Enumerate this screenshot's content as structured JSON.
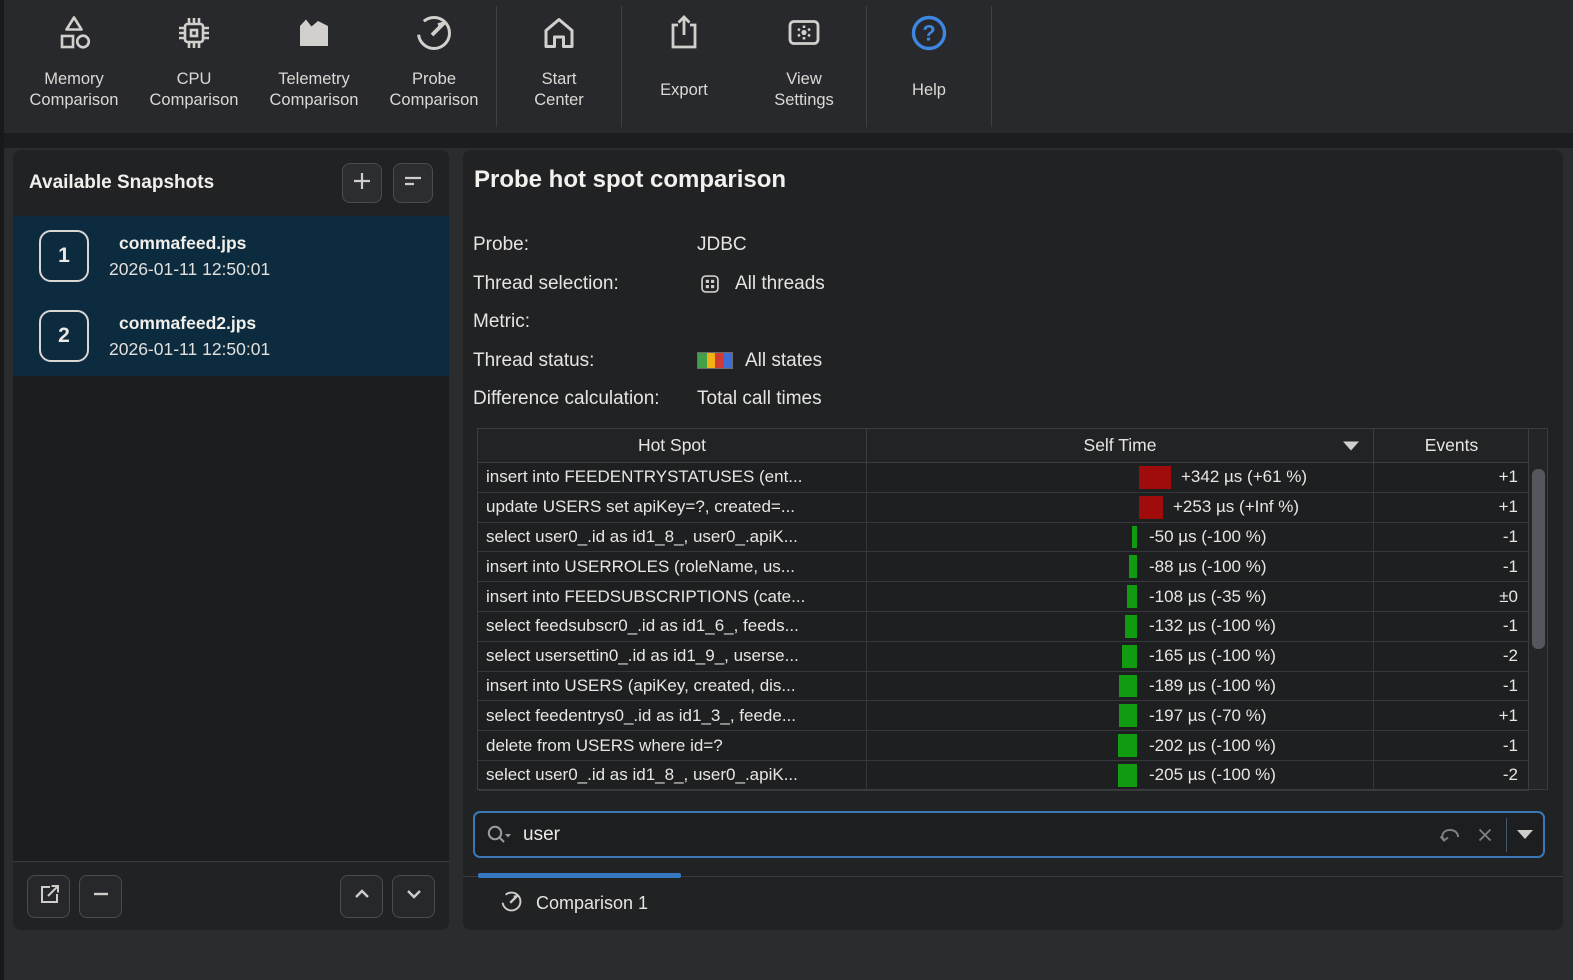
{
  "toolbar": {
    "items": [
      {
        "name": "toolbar-memory-comparison",
        "icon": "memory-comparison-icon",
        "lines": [
          "Memory",
          "Comparison"
        ],
        "sep_after": false,
        "accent": false
      },
      {
        "name": "toolbar-cpu-comparison",
        "icon": "cpu-comparison-icon",
        "lines": [
          "CPU",
          "Comparison"
        ],
        "sep_after": false,
        "accent": false
      },
      {
        "name": "toolbar-telemetry-comparison",
        "icon": "telemetry-comparison-icon",
        "lines": [
          "Telemetry",
          "Comparison"
        ],
        "sep_after": false,
        "accent": false
      },
      {
        "name": "toolbar-probe-comparison",
        "icon": "probe-comparison-icon",
        "lines": [
          "Probe",
          "Comparison"
        ],
        "sep_after": true,
        "accent": false
      },
      {
        "name": "toolbar-start-center",
        "icon": "start-center-icon",
        "lines": [
          "Start",
          "Center"
        ],
        "sep_after": true,
        "accent": false
      },
      {
        "name": "toolbar-export",
        "icon": "export-icon",
        "lines": [
          "Export"
        ],
        "sep_after": false,
        "accent": false
      },
      {
        "name": "toolbar-view-settings",
        "icon": "view-settings-icon",
        "lines": [
          "View",
          "Settings"
        ],
        "sep_after": true,
        "accent": false
      },
      {
        "name": "toolbar-help",
        "icon": "help-icon",
        "lines": [
          "Help"
        ],
        "sep_after": true,
        "accent": true
      }
    ]
  },
  "sidebar": {
    "title": "Available Snapshots",
    "snapshots": [
      {
        "index": "1",
        "name": "commafeed.jps",
        "timestamp": "2026-01-11 12:50:01"
      },
      {
        "index": "2",
        "name": "commafeed2.jps",
        "timestamp": "2026-01-11 12:50:01"
      }
    ]
  },
  "main": {
    "title": "Probe hot spot comparison",
    "properties": [
      {
        "label": "Probe:",
        "value": "JDBC",
        "icon": ""
      },
      {
        "label": "Thread selection:",
        "value": "All threads",
        "icon": "threads-grid-icon"
      },
      {
        "label": "Metric:",
        "value": "",
        "icon": ""
      },
      {
        "label": "Thread status:",
        "value": "All states",
        "icon": "thread-states-icon"
      },
      {
        "label": "Difference calculation:",
        "value": "Total call times",
        "icon": ""
      }
    ],
    "thread_state_colors": [
      "#43a047",
      "#f2b217",
      "#d23b33",
      "#3f6cd6"
    ],
    "table": {
      "columns": [
        "Hot Spot",
        "Self Time",
        "Events"
      ],
      "sorted_column": "Self Time",
      "rows": [
        {
          "hotspot": "insert into FEEDENTRYSTATUSES (ent...",
          "self_label": "+342 µs (+61 %)",
          "us": 342,
          "events": "+1"
        },
        {
          "hotspot": "update USERS set apiKey=?, created=...",
          "self_label": "+253 µs (+Inf %)",
          "us": 253,
          "events": "+1"
        },
        {
          "hotspot": "select user0_.id as id1_8_, user0_.apiK...",
          "self_label": "-50 µs (-100 %)",
          "us": -50,
          "events": "-1"
        },
        {
          "hotspot": "insert into USERROLES (roleName, us...",
          "self_label": "-88 µs (-100 %)",
          "us": -88,
          "events": "-1"
        },
        {
          "hotspot": "insert into FEEDSUBSCRIPTIONS (cate...",
          "self_label": "-108 µs (-35 %)",
          "us": -108,
          "events": "±0"
        },
        {
          "hotspot": "select feedsubscr0_.id as id1_6_, feeds...",
          "self_label": "-132 µs (-100 %)",
          "us": -132,
          "events": "-1"
        },
        {
          "hotspot": "select usersettin0_.id as id1_9_, userse...",
          "self_label": "-165 µs (-100 %)",
          "us": -165,
          "events": "-2"
        },
        {
          "hotspot": "insert into USERS (apiKey, created, dis...",
          "self_label": "-189 µs (-100 %)",
          "us": -189,
          "events": "-1"
        },
        {
          "hotspot": "select feedentrys0_.id as id1_3_, feede...",
          "self_label": "-197 µs (-70 %)",
          "us": -197,
          "events": "+1"
        },
        {
          "hotspot": "delete from USERS where id=?",
          "self_label": "-202 µs (-100 %)",
          "us": -202,
          "events": "-1"
        },
        {
          "hotspot": "select user0_.id as id1_8_, user0_.apiK...",
          "self_label": "-205 µs (-100 %)",
          "us": -205,
          "events": "-2"
        }
      ],
      "bar_colors": {
        "increase": "#a00c0c",
        "decrease": "#109b10"
      }
    },
    "search": {
      "value": "user"
    },
    "tab": {
      "label": "Comparison 1"
    },
    "accent_color": "#3577c1"
  }
}
